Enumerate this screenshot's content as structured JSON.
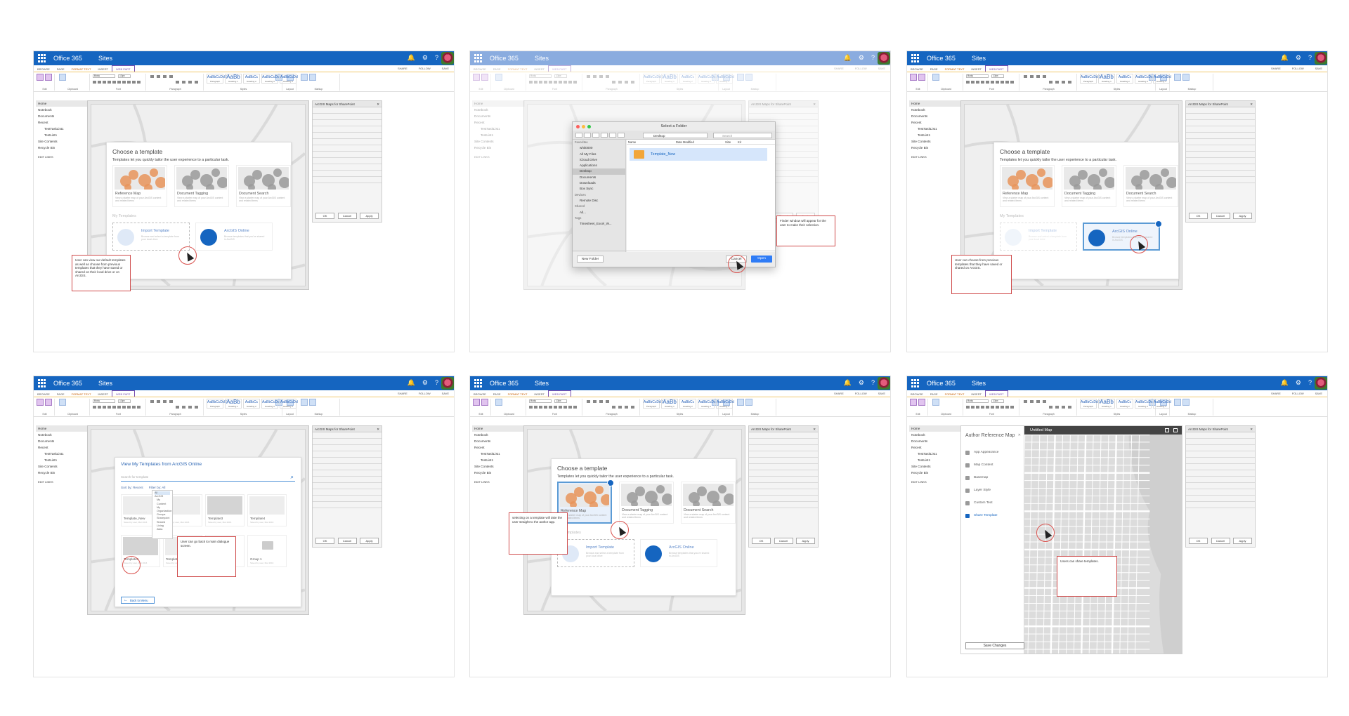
{
  "shell": {
    "app_name": "Office 365",
    "site_label": "Sites",
    "ribbon_tabs": [
      "BROWSE",
      "PAGE",
      "FORMAT TEXT",
      "INSERT",
      "WEB PART"
    ],
    "ribbon_right": [
      "SHARE",
      "FOLLOW",
      "SAVE"
    ],
    "ribbon_groups": [
      "Edit",
      "Clipboard",
      "Font",
      "Paragraph",
      "Styles",
      "Layout",
      "Markup"
    ],
    "font_name": "Body",
    "font_size": "13px",
    "style_samples": [
      "AaBbCcDdE",
      "AaBb",
      "AaBbCc",
      "AaBbCcDc",
      "AaBbCcDd"
    ],
    "style_names": [
      "Paragraph",
      "Heading 1",
      "Heading 2",
      "Heading 3",
      "Heading 4"
    ],
    "nav": [
      "Home",
      "Notebook",
      "Documents",
      "Recent",
      "TestTaskList1",
      "TestList1",
      "Site Contents",
      "Recycle Bin"
    ],
    "edit_links": "EDIT LINKS",
    "sidepane_title": "ArcGIS Maps for SharePoint",
    "sidepane_buttons": [
      "OK",
      "Cancel",
      "Apply"
    ]
  },
  "choose_template": {
    "title": "Choose a template",
    "subtitle": "Templates let you quickly tailor the user experience to a particular task.",
    "templates": [
      "Reference Map",
      "Document Tagging",
      "Document Search"
    ],
    "template_desc": "View a starter map of your ArcGIS content and related items",
    "my_templates_label": "My Templates",
    "import_title": "Import Template",
    "import_desc": "Browse and select a template from your local drive",
    "arcgis_title": "ArcGIS Online",
    "arcgis_desc": "Browse templates that you've shared in ArcGIS"
  },
  "panel1": {
    "note": "User can view our default templates as well as choose from previous templates that they have saved or shared on their local drive or on ArcGIS."
  },
  "panel2": {
    "window_title": "Select a Folder",
    "location": "Desktop",
    "search_placeholder": "Search",
    "favorites_label": "Favorites",
    "favorites": [
      "whit0000",
      "All My Files",
      "iCloud Drive",
      "Applications",
      "Desktop",
      "Documents",
      "Downloads",
      "Box Sync"
    ],
    "devices_label": "Devices",
    "devices": [
      "Remote Disc"
    ],
    "shared_label": "Shared",
    "shared": [
      "All..."
    ],
    "tags_label": "Tags",
    "tags": [
      "Timesheet_Excel_W..."
    ],
    "columns": [
      "Name",
      "Date Modified",
      "Size",
      "Kir"
    ],
    "selected_item": "Template_New",
    "new_folder": "New Folder",
    "cancel": "Cancel",
    "open": "Open",
    "note": "Finder window will appear for the user to make their selection."
  },
  "panel3": {
    "note": "User can choose from previous templates that they have saved or shared on ArcGIS."
  },
  "panel4": {
    "title": "View My Templates from ArcGIS Online",
    "search_placeholder": "Search for template",
    "sort_label": "Sort by: Recent",
    "filter_label": "Filter by: All",
    "filter_options": [
      "All",
      "ArcGIS",
      "My Content",
      "My Organization",
      "Groups",
      "Sharepoint",
      "Shared",
      "Living Atlas"
    ],
    "cards": [
      "Template_New",
      "ate2",
      "Template3",
      "Template4",
      "Template5",
      "Template6",
      "",
      "Group 1"
    ],
    "card_desc": "Saved by user, Mar 2016",
    "back": "Back to Menu",
    "note": "User can go back to main dialogue screen."
  },
  "panel5": {
    "note": "selecting on a template will take the user straight to the author app."
  },
  "panel6": {
    "title": "Author Reference Map",
    "map_title": "Untitled Map",
    "items": [
      "App Appearance",
      "Map Content",
      "Basemap",
      "Layer Style",
      "Custom Text",
      "Share Template"
    ],
    "save": "Save Changes",
    "note": "Users can share templates."
  }
}
